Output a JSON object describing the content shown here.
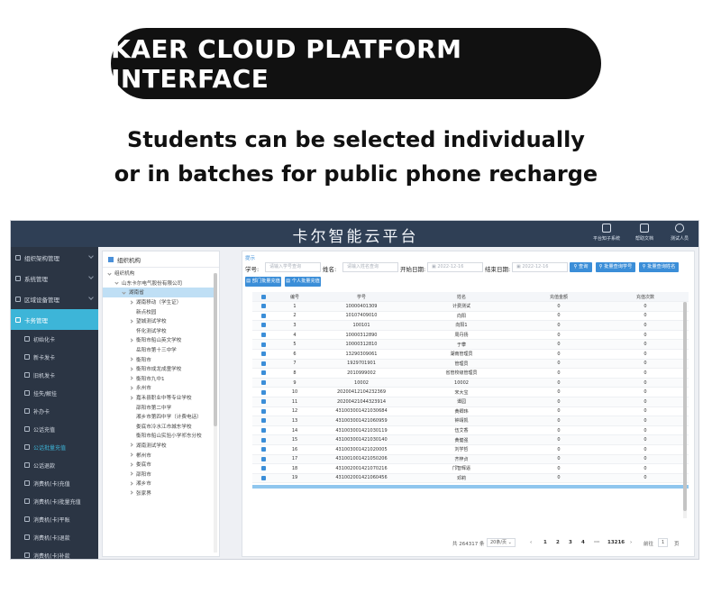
{
  "banner": {
    "title": "KAER CLOUD PLATFORM INTERFACE"
  },
  "subtitle": {
    "line1": "Students can be selected individually",
    "line2": "or in batches for public phone recharge"
  },
  "app": {
    "title": "卡尔智能云平台",
    "topbar_items": [
      {
        "label": "平台知子系统",
        "icon": "monitor-icon"
      },
      {
        "label": "帮助文档",
        "icon": "document-icon"
      },
      {
        "label": "测试人员",
        "icon": "user-icon"
      }
    ]
  },
  "sidebar": {
    "items": [
      {
        "label": "组织架构管理",
        "level": "top",
        "icon": "org-icon"
      },
      {
        "label": "系统管理",
        "level": "top",
        "icon": "gear-icon"
      },
      {
        "label": "区域设备管理",
        "level": "top",
        "icon": "device-icon"
      },
      {
        "label": "卡务管理",
        "level": "top",
        "icon": "card-icon",
        "active": true
      },
      {
        "label": "初始化卡",
        "level": "sub",
        "icon": "card-icon"
      },
      {
        "label": "新卡发卡",
        "level": "sub",
        "icon": "card-icon"
      },
      {
        "label": "旧机发卡",
        "level": "sub",
        "icon": "card-icon"
      },
      {
        "label": "挂失/解挂",
        "level": "sub",
        "icon": "link-icon"
      },
      {
        "label": "补办卡",
        "level": "sub",
        "icon": "card-icon"
      },
      {
        "label": "公话充值",
        "level": "sub",
        "icon": "card-icon"
      },
      {
        "label": "公话批量充值",
        "level": "sub",
        "icon": "card-icon",
        "current": true
      },
      {
        "label": "公话退款",
        "level": "sub",
        "icon": "card-icon"
      },
      {
        "label": "消费机(卡)充值",
        "level": "sub",
        "icon": "card-icon"
      },
      {
        "label": "消费机(卡)批量充值",
        "level": "sub",
        "icon": "card-icon"
      },
      {
        "label": "消费机(卡)平账",
        "level": "sub",
        "icon": "card-icon"
      },
      {
        "label": "消费机(卡)退款",
        "level": "sub",
        "icon": "card-icon"
      },
      {
        "label": "消费机(卡)补款",
        "level": "sub",
        "icon": "card-icon"
      }
    ]
  },
  "tree": {
    "header": "组织机构",
    "nodes": [
      {
        "label": "组织机构",
        "depth": 0,
        "arrow": "open"
      },
      {
        "label": "山东卡尔电气股份有限公司",
        "depth": 1,
        "arrow": "open"
      },
      {
        "label": "湖南省",
        "depth": 2,
        "arrow": "open",
        "selected": true
      },
      {
        "label": "湖南移动（学生证）",
        "depth": 3,
        "arrow": "closed"
      },
      {
        "label": "新点校园",
        "depth": 3,
        "arrow": "none"
      },
      {
        "label": "望城测试学校",
        "depth": 3,
        "arrow": "closed"
      },
      {
        "label": "怀化测试学校",
        "depth": 3,
        "arrow": "none"
      },
      {
        "label": "衡阳市船山英文学校",
        "depth": 3,
        "arrow": "closed"
      },
      {
        "label": "岳阳市第十三中学",
        "depth": 3,
        "arrow": "none"
      },
      {
        "label": "衡阳市",
        "depth": 3,
        "arrow": "closed"
      },
      {
        "label": "衡阳市成龙成童学校",
        "depth": 3,
        "arrow": "closed"
      },
      {
        "label": "衡阳市九中1",
        "depth": 3,
        "arrow": "closed"
      },
      {
        "label": "永州市",
        "depth": 3,
        "arrow": "closed"
      },
      {
        "label": "嘉禾县职业中等专业学校",
        "depth": 3,
        "arrow": "closed"
      },
      {
        "label": "邵阳市第二中学",
        "depth": 3,
        "arrow": "none"
      },
      {
        "label": "湘乡市第四中学（计费电话）",
        "depth": 3,
        "arrow": "none"
      },
      {
        "label": "娄底市冷水江市城东学校",
        "depth": 3,
        "arrow": "none"
      },
      {
        "label": "衡阳市船山实验小学祁东分校",
        "depth": 3,
        "arrow": "none"
      },
      {
        "label": "湖南测试学校",
        "depth": 3,
        "arrow": "closed"
      },
      {
        "label": "郴州市",
        "depth": 3,
        "arrow": "closed"
      },
      {
        "label": "娄底市",
        "depth": 3,
        "arrow": "closed"
      },
      {
        "label": "邵阳市",
        "depth": 3,
        "arrow": "closed"
      },
      {
        "label": "湘乡市",
        "depth": 3,
        "arrow": "closed"
      },
      {
        "label": "张家界",
        "depth": 3,
        "arrow": "closed"
      }
    ]
  },
  "main": {
    "hint": "提示",
    "batch_button": "部门批量充值",
    "single_button": "个人批量充值",
    "form": {
      "id_label": "学号:",
      "id_placeholder": "请输入学号查询",
      "name_label": "姓名:",
      "name_placeholder": "请输入姓名查询",
      "start_label": "开始日期:",
      "start_value": "2022-12-16",
      "end_label": "结束日期:",
      "end_value": "2022-12-16",
      "search_button": "查询",
      "by_id_button": "批量查询学号",
      "by_name_button": "批量查询姓名"
    },
    "table": {
      "columns": [
        "编号",
        "学号",
        "姓名",
        "充值金额",
        "充值次数"
      ],
      "rows": [
        [
          "1",
          "10000401309",
          "计费测试",
          "0",
          "0"
        ],
        [
          "2",
          "10107409010",
          "向阳",
          "0",
          "0"
        ],
        [
          "3",
          "100101",
          "向阳1",
          "0",
          "0"
        ],
        [
          "4",
          "10000312890",
          "周丹扬",
          "0",
          "0"
        ],
        [
          "5",
          "10000312810",
          "于攀",
          "0",
          "0"
        ],
        [
          "6",
          "13290309061",
          "湖南管理员",
          "0",
          "0"
        ],
        [
          "7",
          "1929701901",
          "管理员",
          "0",
          "0"
        ],
        [
          "8",
          "2010999002",
          "省管校级管理员",
          "0",
          "0"
        ],
        [
          "9",
          "10002",
          "10002",
          "0",
          "0"
        ],
        [
          "10",
          "20200412104232369",
          "宋大宝",
          "0",
          "0"
        ],
        [
          "11",
          "20200421044323914",
          "谭园",
          "0",
          "0"
        ],
        [
          "12",
          "431003001421030684",
          "黄卿玮",
          "0",
          "0"
        ],
        [
          "13",
          "431003001421060959",
          "钟靖凯",
          "0",
          "0"
        ],
        [
          "14",
          "431003001421030119",
          "伍艾香",
          "0",
          "0"
        ],
        [
          "15",
          "431003001421030140",
          "黄健强",
          "0",
          "0"
        ],
        [
          "16",
          "431003001421020005",
          "刘学哲",
          "0",
          "0"
        ],
        [
          "17",
          "431001001421050206",
          "齐梓贞",
          "0",
          "0"
        ],
        [
          "18",
          "431002001421070216",
          "邝智辉逼",
          "0",
          "0"
        ],
        [
          "19",
          "431002001421060456",
          "邓莉",
          "0",
          "0"
        ]
      ]
    },
    "pager": {
      "total": "共 264317 条",
      "page_size": "20条/页",
      "pages": [
        "1",
        "2",
        "3",
        "4",
        "···",
        "13216"
      ],
      "goto_label": "前往",
      "goto_value": "1",
      "page_unit": "页"
    }
  }
}
